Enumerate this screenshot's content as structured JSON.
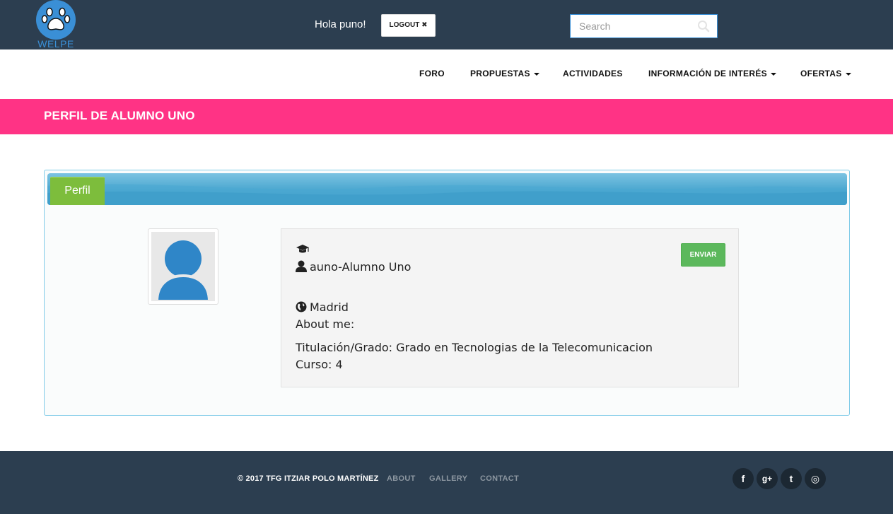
{
  "header": {
    "logo_text": "WELPE",
    "greeting": "Hola puno!",
    "logout_label": "LOGOUT ✖",
    "search_placeholder": "Search"
  },
  "nav": {
    "items": [
      {
        "label": "FORO",
        "has_dropdown": false
      },
      {
        "label": "PROPUESTAS",
        "has_dropdown": true
      },
      {
        "label": "ACTIVIDADES",
        "has_dropdown": false
      },
      {
        "label": "INFORMACIÓN DE INTERÉS",
        "has_dropdown": true
      },
      {
        "label": "OFERTAS",
        "has_dropdown": true
      }
    ]
  },
  "page": {
    "title": "PERFIL DE ALUMNO UNO"
  },
  "profile": {
    "tab_label": "Perfil",
    "username": "auno-Alumno Uno",
    "location": "Madrid",
    "about": "About me:",
    "degree": "Titulación/Grado: Grado en Tecnologias de la Telecomunicacion",
    "course": "Curso: 4",
    "send_label": "ENVIAR"
  },
  "footer": {
    "copyright": "© 2017 TFG ITZIAR POLO MARTÍNEZ",
    "links": [
      "ABOUT",
      "GALLERY",
      "CONTACT"
    ],
    "social": [
      {
        "icon": "facebook-icon",
        "glyph": "f"
      },
      {
        "icon": "google-plus-icon",
        "glyph": "g+"
      },
      {
        "icon": "twitter-icon",
        "glyph": "t"
      },
      {
        "icon": "dribbble-icon",
        "glyph": "◎"
      }
    ]
  },
  "colors": {
    "topbar": "#2c3e50",
    "accent_pink": "#ff3385",
    "brand_blue": "#3a8fd6",
    "tab_green": "#7dbd3c",
    "button_green": "#5cb85c"
  }
}
